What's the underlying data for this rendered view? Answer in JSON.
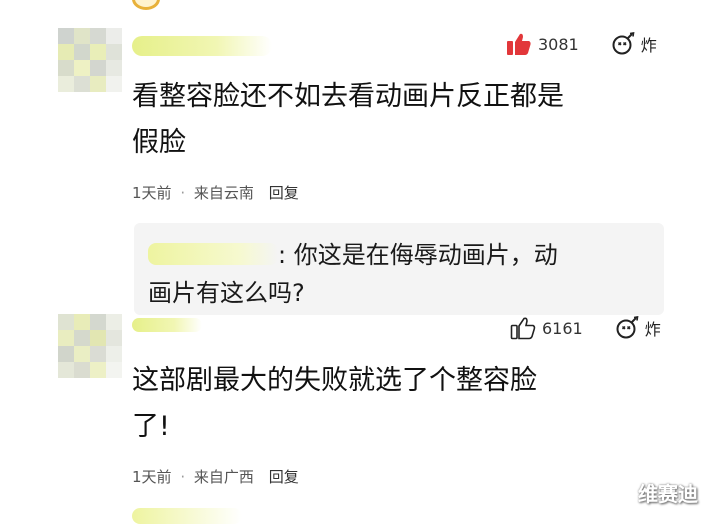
{
  "comments": [
    {
      "likes": "3081",
      "like_icon": "thumbs-up-filled",
      "bomb_label": "炸",
      "text_lines": [
        "看整容脸还不如去看动画片反正都是",
        "假脸"
      ],
      "time": "1天前",
      "separator": "·",
      "location": "来自云南",
      "reply_label": "回复"
    },
    {
      "likes": "6161",
      "like_icon": "thumbs-up-outline",
      "bomb_label": "炸",
      "text_lines": [
        "这部剧最大的失败就选了个整容脸",
        "了!"
      ],
      "time": "1天前",
      "separator": "·",
      "location": "来自广西",
      "reply_label": "回复"
    }
  ],
  "nested_reply": {
    "separator": ":",
    "line1": "你这是在侮辱动画片，动",
    "line2": "画片有这么吗?"
  },
  "watermark": "维赛迪",
  "colors": {
    "like_red": "#e2373a",
    "text": "#111111",
    "meta_gray": "#555555",
    "reply_bg": "#f4f4f4"
  }
}
